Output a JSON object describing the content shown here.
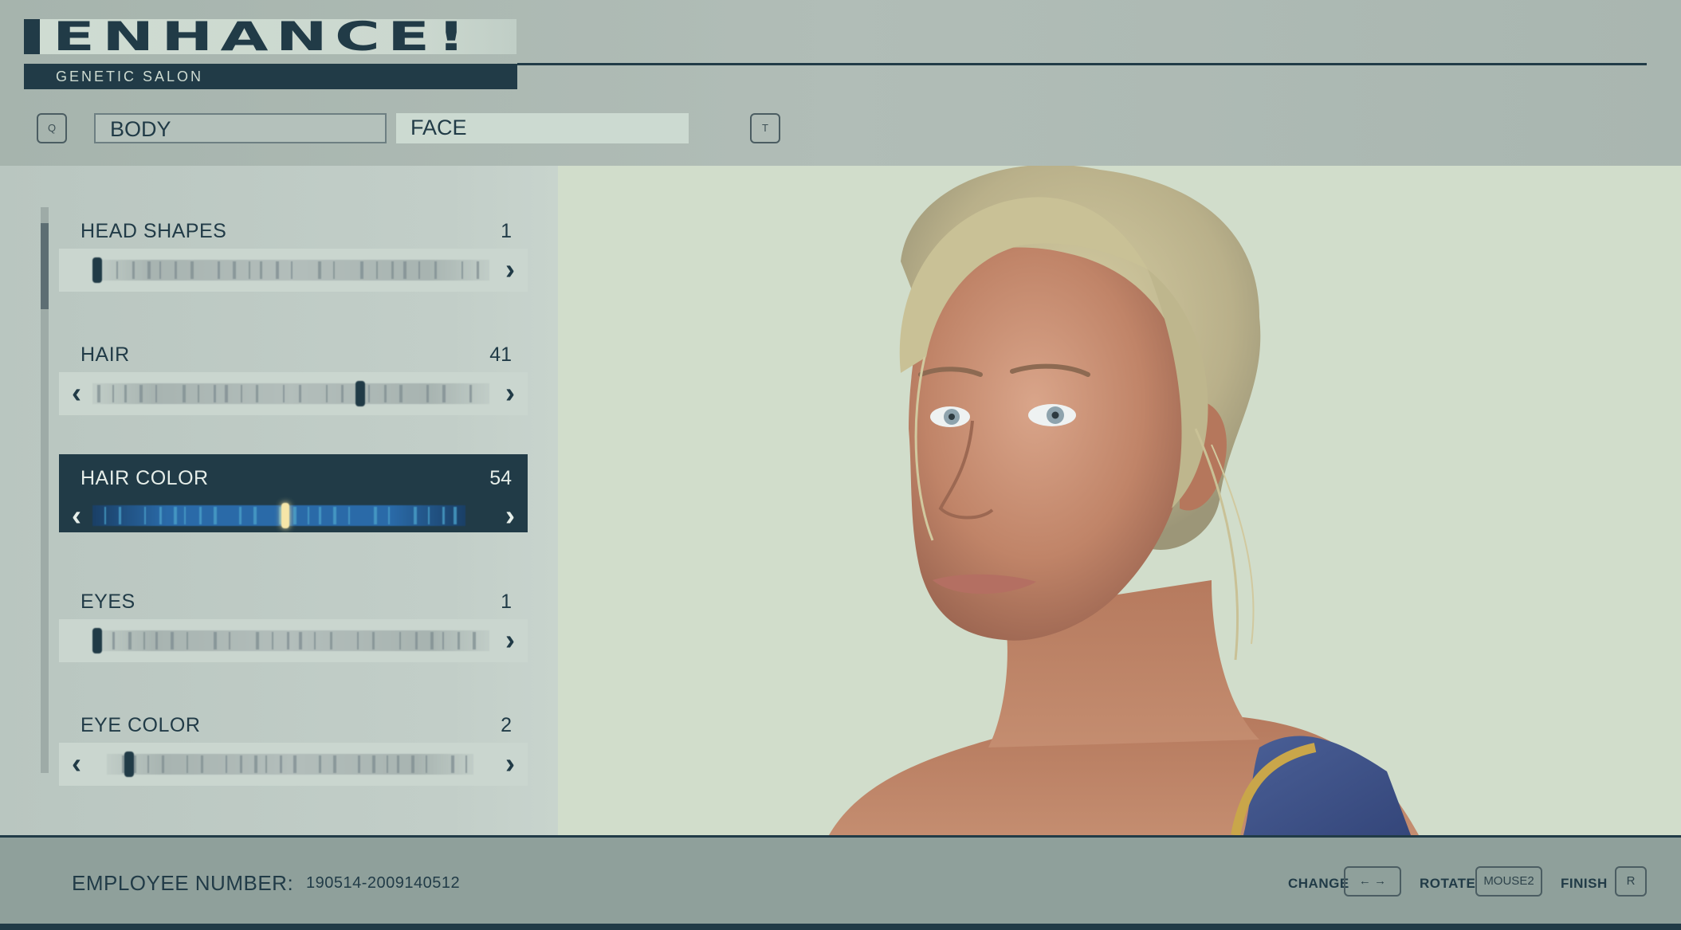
{
  "header": {
    "logo_text": "ENHANCE!",
    "subtitle": "GENETIC SALON",
    "prev_key": "Q",
    "next_key": "T",
    "tabs": [
      {
        "label": "BODY"
      },
      {
        "label": "FACE"
      }
    ]
  },
  "options": [
    {
      "label": "HEAD SHAPES",
      "value": "1",
      "has_left_arrow": false,
      "level": 0.0
    },
    {
      "label": "HAIR",
      "value": "41",
      "has_left_arrow": true,
      "level": 0.68
    },
    {
      "label": "HAIR COLOR",
      "value": "54",
      "has_left_arrow": true,
      "level": 0.52,
      "selected": true
    },
    {
      "label": "EYES",
      "value": "1",
      "has_left_arrow": false,
      "level": 0.0
    },
    {
      "label": "EYE COLOR",
      "value": "2",
      "has_left_arrow": true,
      "level": 0.05
    }
  ],
  "footer": {
    "employee_label": "EMPLOYEE NUMBER:",
    "employee_number": "190514-2009140512",
    "change_label": "CHANGE",
    "change_key": "← →",
    "rotate_label": "ROTATE",
    "rotate_key": "MOUSE2",
    "finish_label": "FINISH",
    "finish_key": "R"
  },
  "colors": {
    "navy": "#213b47",
    "panel": "#c2cec8",
    "preview_bg": "#d1ddcb",
    "selected_track": "#2a6aa8"
  }
}
